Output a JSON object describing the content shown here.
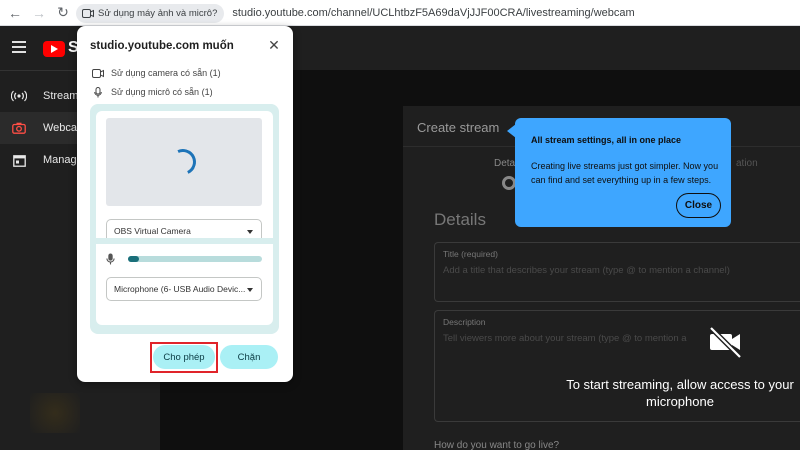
{
  "browser": {
    "permission_chip": "Sử dụng máy ảnh và micrô?",
    "url": "studio.youtube.com/channel/UCLhtbzF5A69daVjJJF00CRA/livestreaming/webcam"
  },
  "studio": {
    "logo_letter": "S",
    "sidebar": [
      {
        "label": "Stream",
        "icon": "broadcast-icon"
      },
      {
        "label": "Webcam",
        "icon": "camera-icon",
        "active": true
      },
      {
        "label": "Manage",
        "icon": "calendar-icon"
      }
    ],
    "create_panel": {
      "title": "Create stream",
      "step_left": "Detai",
      "step_right": "ation",
      "details_heading": "Details",
      "title_field_label": "Title (required)",
      "title_field_placeholder": "Add a title that describes your stream (type @ to mention a channel)",
      "description_label": "Description",
      "description_placeholder": "Tell viewers more about your stream (type @ to mention a",
      "how_label": "How do you want to go live?"
    },
    "stream_message": "To start streaming, allow access to your microphone",
    "tooltip": {
      "title": "All stream settings, all in one place",
      "body": "Creating live streams just got simpler. Now you can find and set everything up in a few steps.",
      "close": "Close"
    }
  },
  "permission_popup": {
    "heading": "studio.youtube.com muốn",
    "camera_row": "Sử dụng camera có sẵn (1)",
    "mic_row": "Sử dụng micrô có sẵn (1)",
    "camera_select": "OBS Virtual Camera",
    "mic_select": "Microphone (6- USB Audio Devic...",
    "mic_level": 0.08,
    "allow_button": "Cho phép",
    "block_button": "Chặn"
  },
  "colors": {
    "accent_blue": "#3ea6ff",
    "popup_button": "#aaf0f5",
    "highlight_red": "#e0242a"
  }
}
